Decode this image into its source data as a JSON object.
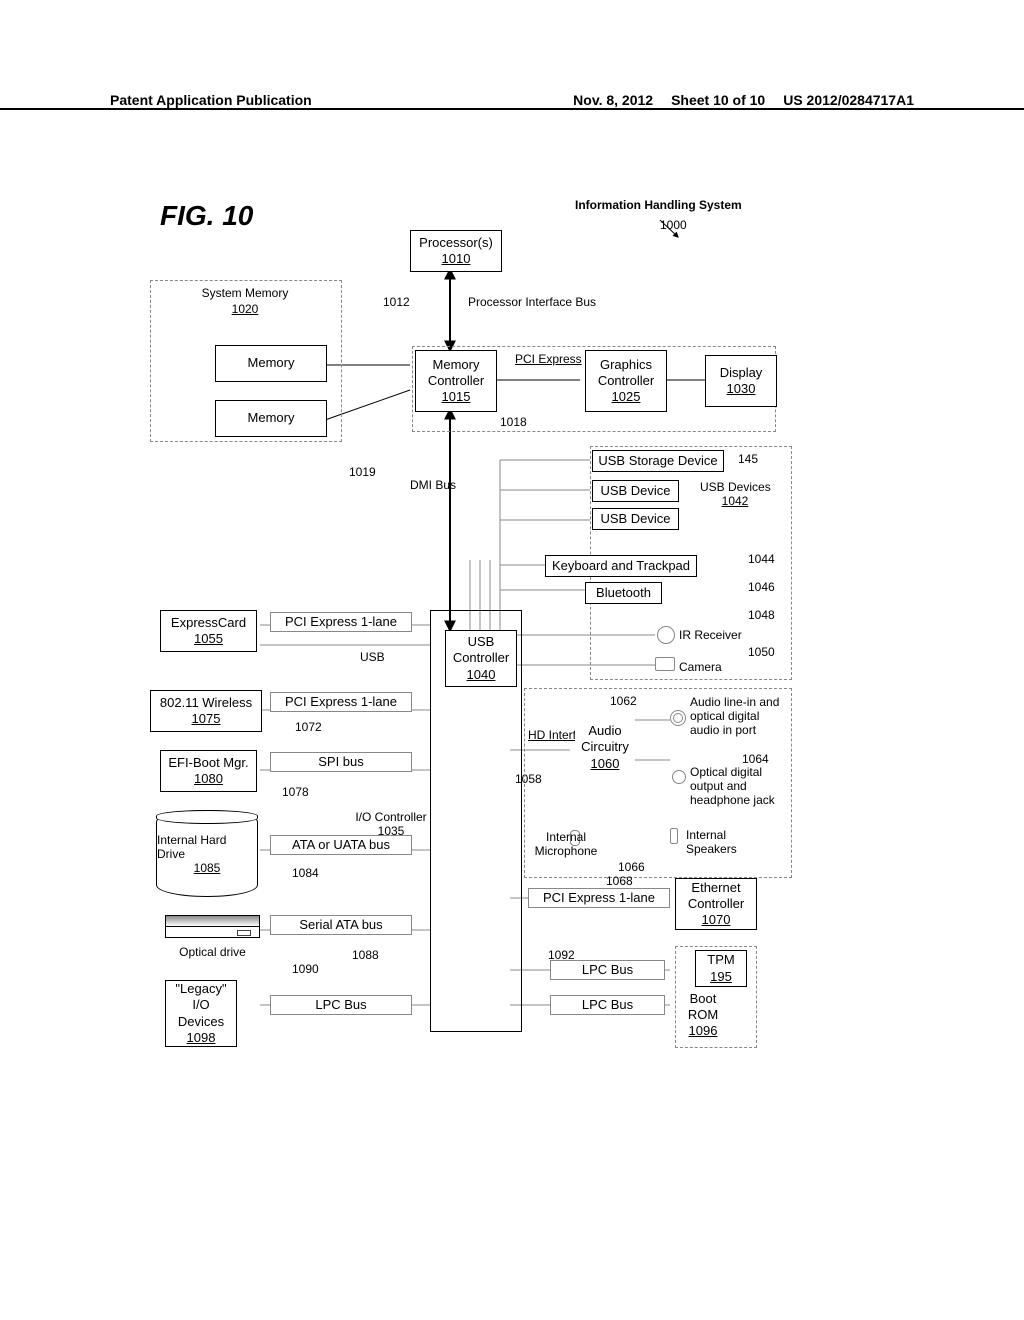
{
  "header": {
    "left": "Patent Application Publication",
    "center": "Nov. 8, 2012",
    "sheet": "Sheet 10 of 10",
    "pubno": "US 2012/0284717A1"
  },
  "fig": {
    "title": "FIG. 10"
  },
  "system": {
    "title": "Information Handling System",
    "ref": "1000"
  },
  "blocks": {
    "processor": {
      "label": "Processor(s)",
      "ref": "1010"
    },
    "pif_bus": {
      "label": "Processor Interface Bus",
      "ref": "1012"
    },
    "sysmem_title": "System Memory",
    "sysmem_ref": "1020",
    "mem": "Memory",
    "memctrl": {
      "label": "Memory Controller",
      "ref": "1015"
    },
    "pcie_label": "PCI Express",
    "pcie_ref": "1018",
    "graphics": {
      "label": "Graphics Controller",
      "ref": "1025"
    },
    "display": {
      "label": "Display",
      "ref": "1030"
    },
    "dmi_label": "DMI Bus",
    "dmi_ref": "1019",
    "usbstorage": "USB Storage Device",
    "usbstorage_ref": "145",
    "usbdev": "USB Device",
    "usbdevs_group": "USB Devices",
    "usbdevs_ref": "1042",
    "kb_track": "Keyboard and Trackpad",
    "kb_track_ref": "1044",
    "bluetooth": "Bluetooth",
    "bluetooth_ref": "1046",
    "ir_recv": "IR Receiver",
    "ir_recv_ref": "1048",
    "camera": "Camera",
    "camera_ref": "1050",
    "usbctrl": {
      "label": "USB Controller",
      "ref": "1040"
    },
    "iocontroller": {
      "label": "I/O Controller",
      "ref": "1035"
    },
    "express_card": {
      "label": "ExpressCard",
      "ref": "1055"
    },
    "pcie1lane": "PCI Express 1-lane",
    "usb_lbl": "USB",
    "wifi": {
      "label": "802.11 Wireless",
      "ref": "1075"
    },
    "wifi_bus_ref": "1072",
    "efi": {
      "label": "EFI-Boot Mgr.",
      "ref": "1080"
    },
    "spi_bus": "SPI bus",
    "spi_ref": "1078",
    "hdd": {
      "label": "Internal Hard Drive",
      "ref": "1085"
    },
    "ata_bus": "ATA or UATA bus",
    "ata_ref": "1084",
    "optical": "Optical drive",
    "sata_bus": "Serial ATA bus",
    "sata_ref_a": "1088",
    "sata_ref_b": "1090",
    "legacy": {
      "l1": "\"Legacy\"",
      "l2": "I/O",
      "l3": "Devices",
      "ref": "1098"
    },
    "lpc_bus": "LPC Bus",
    "hd_iface": "HD Interface",
    "hd_iface_ref": "1058",
    "audio": {
      "label": "Audio Circuitry",
      "ref": "1060"
    },
    "audio_linein_ref": "1062",
    "audio_linein": "Audio line-in and optical digital audio in port",
    "opt_out_ref": "1064",
    "opt_out": "Optical digital output and headphone jack",
    "int_mic": "Internal Microphone",
    "int_spk": "Internal Speakers",
    "mic_ref": "1068",
    "spk_ref": "1066",
    "eth": {
      "label": "Ethernet Controller",
      "ref": "1070"
    },
    "lpc_ref": "1092",
    "tpm": {
      "label": "TPM",
      "ref": "195"
    },
    "bootrom": {
      "l1": "Boot",
      "l2": "ROM",
      "ref": "1096"
    }
  }
}
